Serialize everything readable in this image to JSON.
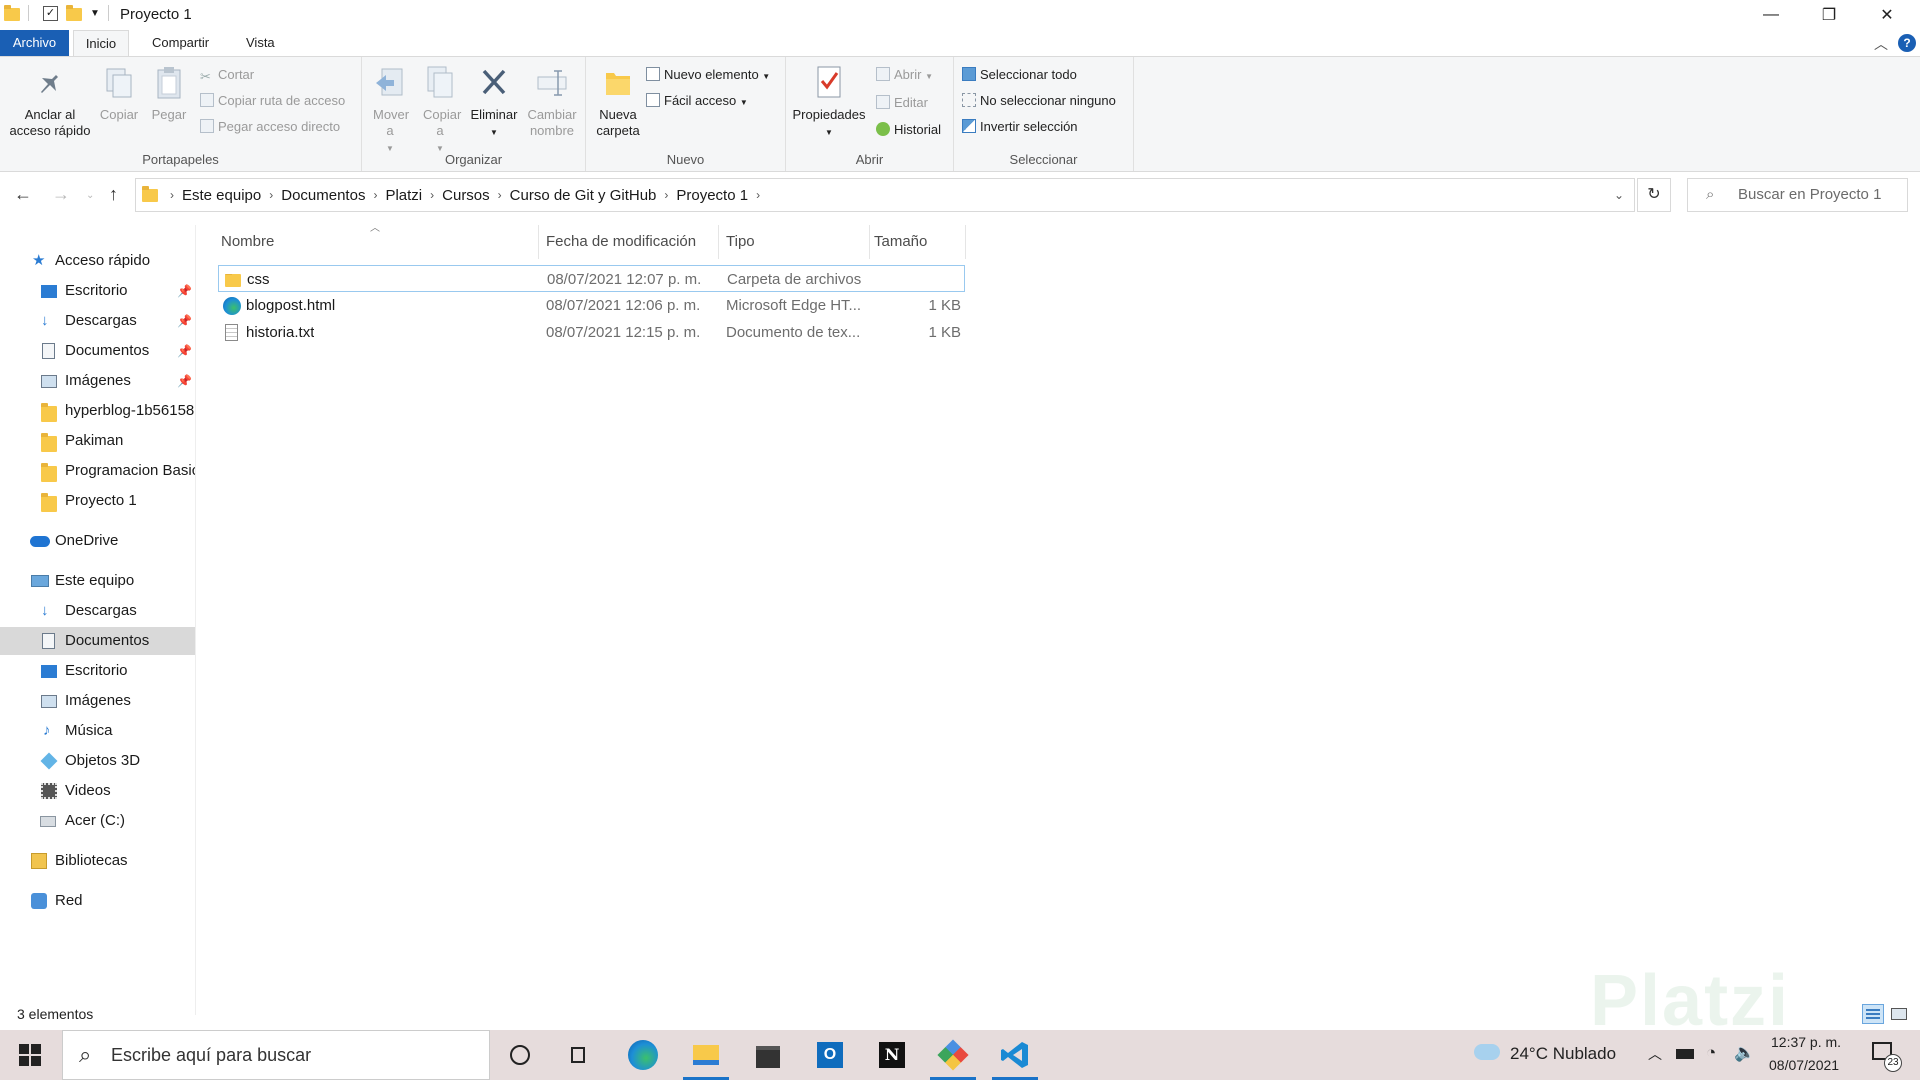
{
  "window": {
    "title": "Proyecto 1",
    "minimize_glyph": "—",
    "restore_glyph": "❐",
    "close_glyph": "✕"
  },
  "tabs": {
    "file": "Archivo",
    "home": "Inicio",
    "share": "Compartir",
    "view": "Vista",
    "help_glyph": "?"
  },
  "ribbon": {
    "portapapeles": {
      "label": "Portapapeles",
      "pin": "Anclar al acceso rápido",
      "copy": "Copiar",
      "paste": "Pegar",
      "cut": "Cortar",
      "copy_path": "Copiar ruta de acceso",
      "paste_shortcut": "Pegar acceso directo"
    },
    "organizar": {
      "label": "Organizar",
      "move": "Mover a",
      "copy_to": "Copiar a",
      "delete": "Eliminar",
      "rename": "Cambiar nombre"
    },
    "nuevo": {
      "label": "Nuevo",
      "new_folder": "Nueva carpeta",
      "new_item": "Nuevo elemento",
      "easy_access": "Fácil acceso"
    },
    "abrir": {
      "label": "Abrir",
      "properties": "Propiedades",
      "open": "Abrir",
      "edit": "Editar",
      "history": "Historial"
    },
    "seleccionar": {
      "label": "Seleccionar",
      "select_all": "Seleccionar todo",
      "select_none": "No seleccionar ninguno",
      "invert": "Invertir selección"
    }
  },
  "address": {
    "crumbs": [
      "Este equipo",
      "Documentos",
      "Platzi",
      "Cursos",
      "Curso de Git y GitHub",
      "Proyecto 1"
    ],
    "search_placeholder": "Buscar en Proyecto 1"
  },
  "nav": {
    "quick_access": "Acceso rápido",
    "quick_items": [
      "Escritorio",
      "Descargas",
      "Documentos",
      "Imágenes",
      "hyperblog-1b56158",
      "Pakiman",
      "Programacion Basic",
      "Proyecto 1"
    ],
    "onedrive": "OneDrive",
    "this_pc": "Este equipo",
    "pc_items": [
      "Descargas",
      "Documentos",
      "Escritorio",
      "Imágenes",
      "Música",
      "Objetos 3D",
      "Videos",
      "Acer (C:)"
    ],
    "libraries": "Bibliotecas",
    "network": "Red"
  },
  "columns": {
    "name": "Nombre",
    "modified": "Fecha de modificación",
    "type": "Tipo",
    "size": "Tamaño"
  },
  "files": [
    {
      "name": "css",
      "modified": "08/07/2021 12:07 p. m.",
      "type": "Carpeta de archivos",
      "size": "",
      "icon": "folder-icon"
    },
    {
      "name": "blogpost.html",
      "modified": "08/07/2021 12:06 p. m.",
      "type": "Microsoft Edge HT...",
      "size": "1 KB",
      "icon": "edge-icon"
    },
    {
      "name": "historia.txt",
      "modified": "08/07/2021 12:15 p. m.",
      "type": "Documento de tex...",
      "size": "1 KB",
      "icon": "text-file-icon"
    }
  ],
  "status": {
    "count": "3 elementos"
  },
  "taskbar": {
    "search_placeholder": "Escribe aquí para buscar",
    "weather": "24°C  Nublado",
    "time": "12:37 p. m.",
    "date": "08/07/2021",
    "notifications": "23"
  },
  "watermark": "Platzi",
  "colors": {
    "accent": "#1a5fb4",
    "selection": "#d9d9d9",
    "taskbar": "#e6dcdc"
  }
}
